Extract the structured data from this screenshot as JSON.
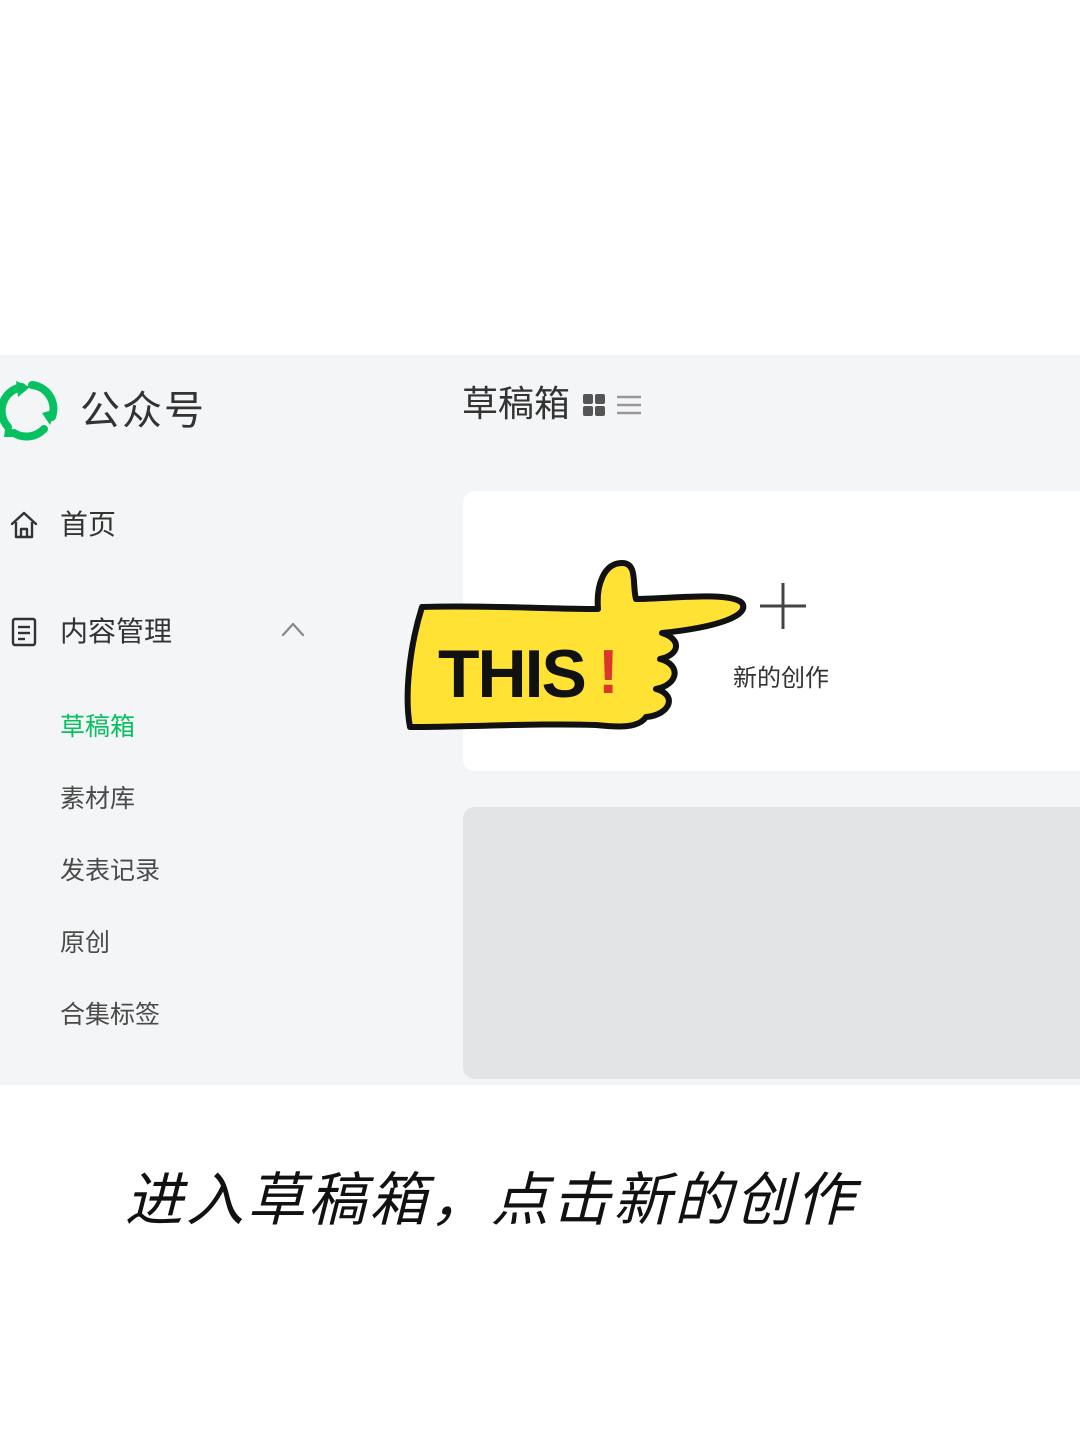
{
  "app": {
    "brand": "公众号",
    "logo_icon": "wechat-official-account-logo",
    "accent_color": "#07c160"
  },
  "sidebar": {
    "home": {
      "label": "首页",
      "icon": "home-icon"
    },
    "content": {
      "label": "内容管理",
      "icon": "document-icon",
      "expanded": true,
      "items": [
        {
          "label": "草稿箱",
          "active": true
        },
        {
          "label": "素材库",
          "active": false
        },
        {
          "label": "发表记录",
          "active": false
        },
        {
          "label": "原创",
          "active": false
        },
        {
          "label": "合集标签",
          "active": false
        }
      ]
    }
  },
  "main": {
    "title": "草稿箱",
    "view_modes": [
      "grid-view-icon",
      "list-view-icon"
    ],
    "new_card": {
      "label": "新的创作",
      "icon": "plus-icon"
    }
  },
  "annotation": {
    "pointer_text": "THIS",
    "pointer_mark": "!",
    "pointer_fill": "#ffe234",
    "pointer_mark_color": "#d9382b",
    "caption": "进入草稿箱，点击新的创作"
  }
}
